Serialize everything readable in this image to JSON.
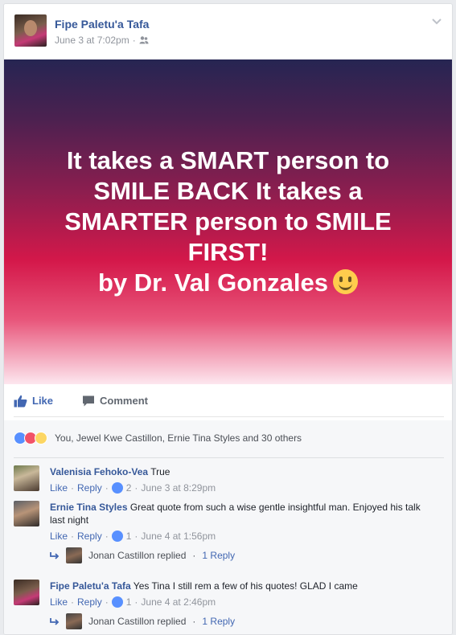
{
  "post": {
    "author": "Fipe Paletu'a Tafa",
    "timestamp": "June 3 at 7:02pm",
    "separator": "·",
    "audience_icon": "friends-icon",
    "menu_icon": "chevron-down-icon"
  },
  "quote": {
    "lines": [
      "It takes a SMART person to",
      "SMILE BACK It takes a",
      "SMARTER person to SMILE",
      "FIRST!",
      "by Dr. Val Gonzales"
    ],
    "emoji": "smiley",
    "colors": {
      "top": "#262552",
      "middle": "#d4184a",
      "bottom": "#fde7ef"
    }
  },
  "actions": {
    "like_label": "Like",
    "comment_label": "Comment"
  },
  "reactions": {
    "icons": [
      "like",
      "love",
      "haha"
    ],
    "summary": "You, Jewel Kwe Castillon, Ernie Tina Styles and 30 others"
  },
  "comments": [
    {
      "author": "Valenisia Fehoko-Vea",
      "text": "True",
      "like_label": "Like",
      "reply_label": "Reply",
      "like_count": "2",
      "time": "June 3 at 8:29pm"
    },
    {
      "author": "Ernie Tina Styles",
      "text": "Great quote from such a wise gentle insightful man. Enjoyed his talk last night",
      "like_label": "Like",
      "reply_label": "Reply",
      "like_count": "1",
      "time": "June 4 at 1:56pm",
      "reply_summary": {
        "name": "Jonan Castillon replied",
        "sep": "·",
        "count": "1 Reply"
      }
    },
    {
      "author": "Fipe Paletu'a Tafa",
      "text": "Yes Tina I still rem a few of his quotes! GLAD I came",
      "like_label": "Like",
      "reply_label": "Reply",
      "like_count": "1",
      "time": "June 4 at 2:46pm",
      "reply_summary": {
        "name": "Jonan Castillon replied",
        "sep": "·",
        "count": "1 Reply"
      }
    }
  ],
  "colors": {
    "link": "#365899",
    "accent": "#4267b2",
    "muted": "#90949c"
  }
}
